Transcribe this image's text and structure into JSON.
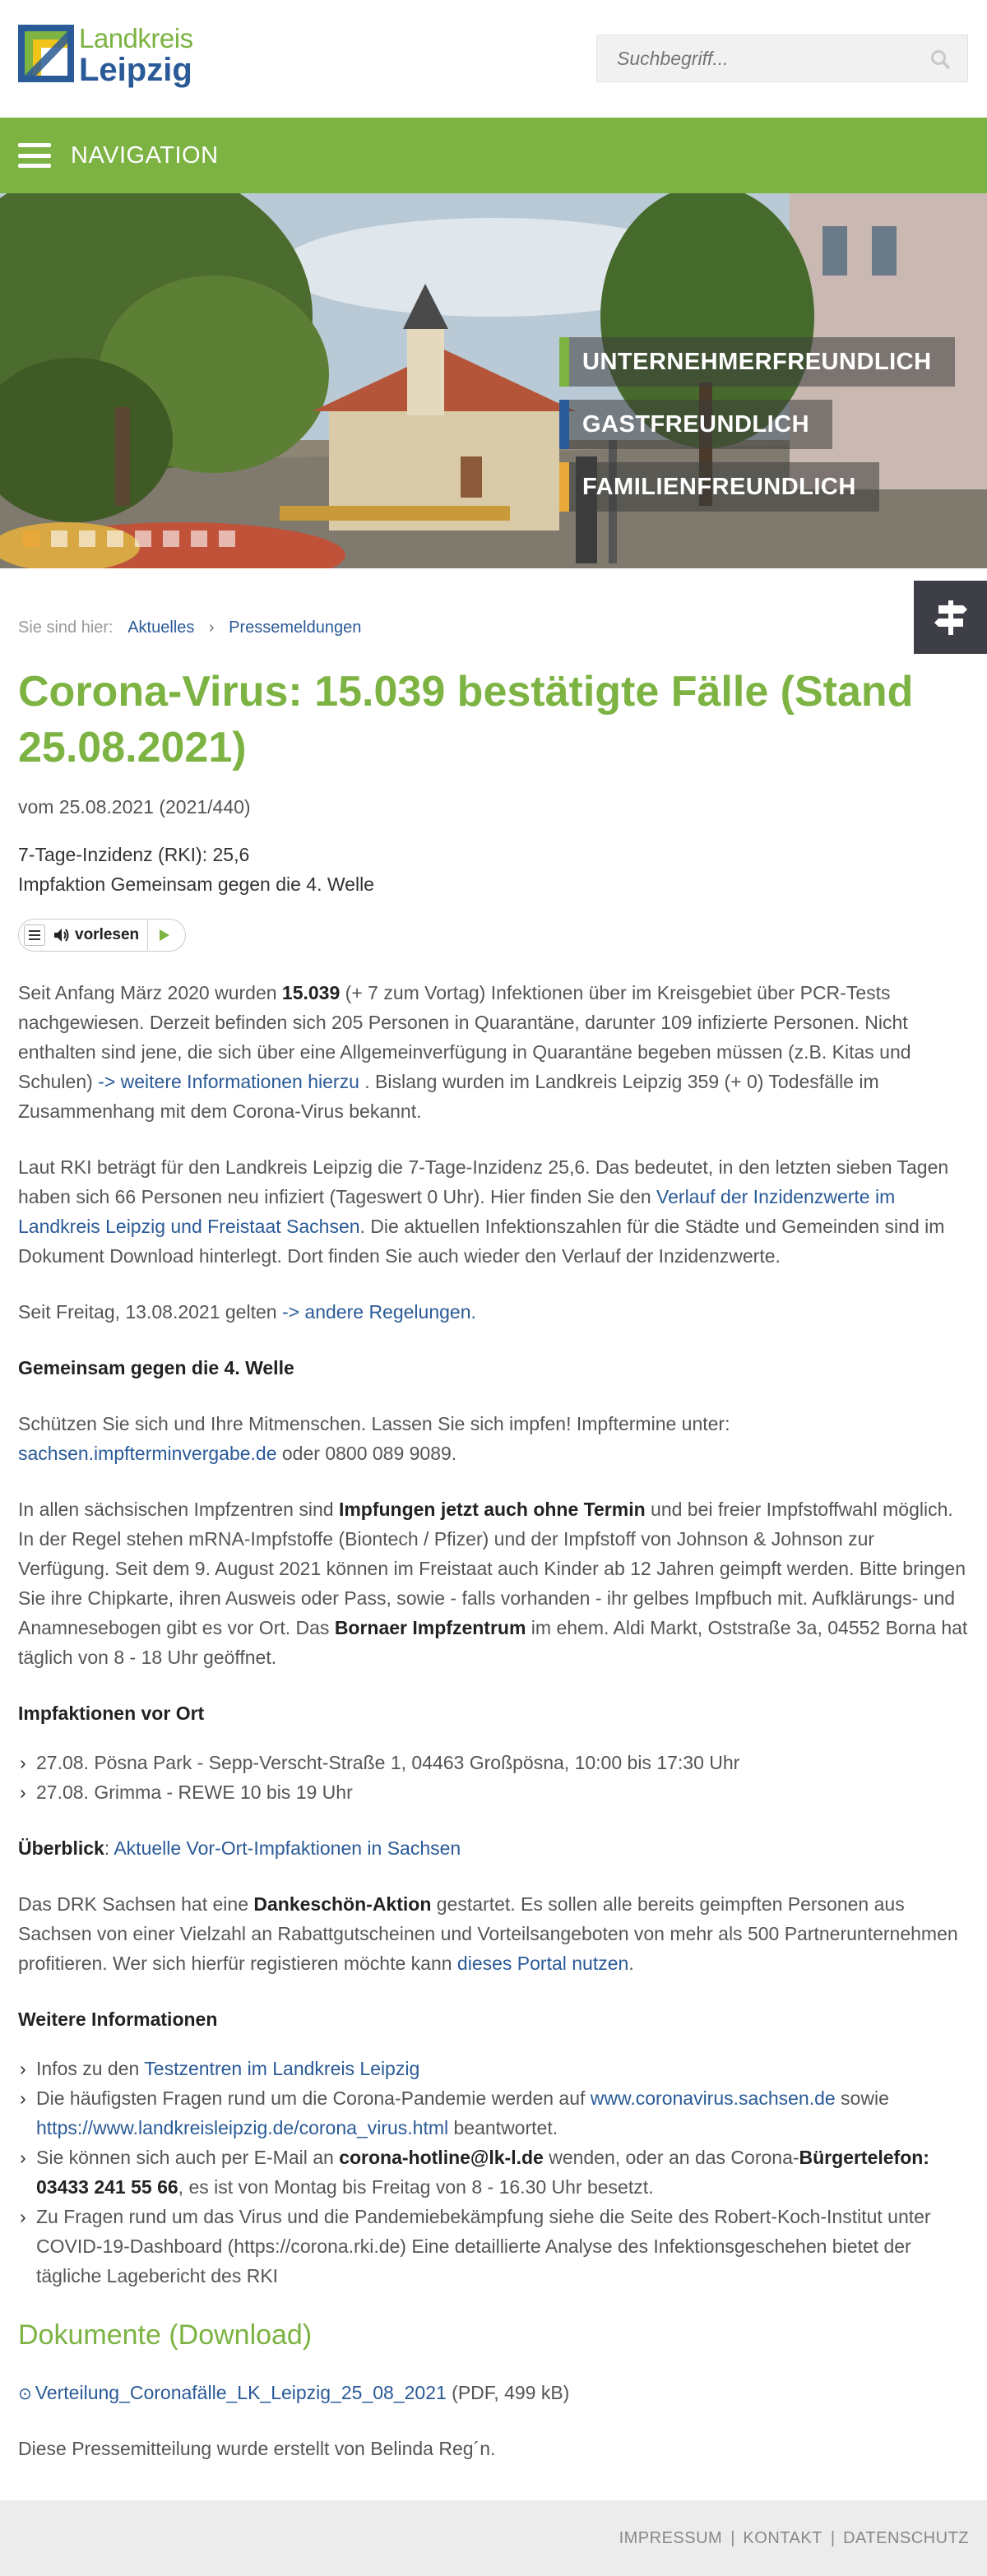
{
  "logo": {
    "line1": "Landkreis",
    "line2": "Leipzig"
  },
  "search": {
    "placeholder": "Suchbegriff..."
  },
  "nav": {
    "label": "NAVIGATION"
  },
  "hero": {
    "slogans": [
      {
        "text": "UNTERNEHMERFREUNDLICH",
        "color": "#7cb342"
      },
      {
        "text": "GASTFREUNDLICH",
        "color": "#2a5a97"
      },
      {
        "text": "FAMILIENFREUNDLICH",
        "color": "#e8a93a"
      }
    ],
    "slide_count": 8,
    "active_slide": 1
  },
  "breadcrumb": {
    "prefix": "Sie sind hier:",
    "items": [
      "Aktuelles",
      "Pressemeldungen"
    ],
    "separator": "›"
  },
  "article": {
    "title": "Corona-Virus: 15.039 bestätigte Fälle (Stand 25.08.2021)",
    "meta": "vom 25.08.2021 (2021/440)",
    "subhead1": "7-Tage-Inzidenz (RKI): 25,6",
    "subhead2": "Impfaktion Gemeinsam gegen die 4. Welle",
    "vorlesen": "vorlesen",
    "p1": {
      "a": "Seit Anfang März 2020 wurden ",
      "b": "15.039",
      "c": " (+ 7 zum Vortag) Infektionen über im Kreisgebiet über PCR-Tests nachgewiesen. Derzeit befinden sich 205 Personen in Quarantäne, darunter 109 infizierte Personen. Nicht enthalten sind jene, die sich über eine Allgemeinverfügung in Quarantäne begeben müssen (z.B. Kitas und Schulen) ",
      "link": "-> weitere Informationen hierzu",
      "d": " . Bislang wurden im Landkreis Leipzig 359 (+ 0) Todesfälle im Zusammenhang mit dem Corona-Virus bekannt."
    },
    "p2": {
      "a": "Laut RKI beträgt für den Landkreis Leipzig die 7-Tage-Inzidenz 25,6. Das bedeutet, in den letzten sieben Tagen haben sich 66 Personen neu infiziert (Tageswert 0 Uhr). Hier finden Sie den ",
      "link": "Verlauf der Inzidenzwerte im Landkreis Leipzig und Freistaat Sachsen",
      "b": ". Die aktuellen Infektionszahlen für die Städte und Gemeinden sind im Dokument Download hinterlegt. Dort finden Sie auch wieder den Verlauf der Inzidenzwerte."
    },
    "p3": {
      "a": "Seit Freitag, 13.08.2021 gelten  ",
      "link": "-> andere Regelungen."
    },
    "h_welle": "Gemeinsam gegen die 4. Welle",
    "p4": {
      "a": "Schützen Sie sich und Ihre Mitmenschen. Lassen Sie sich impfen! Impftermine unter: ",
      "link": "sachsen.impfterminvergabe.de",
      "b": " oder 0800 089 9089."
    },
    "p5": {
      "a": "In allen sächsischen Impfzentren sind ",
      "b": "Impfungen jetzt auch ohne Termin",
      "c": " und bei freier Impfstoffwahl möglich. In der Regel stehen mRNA-Impfstoffe (Biontech / Pfizer) und der Impfstoff von Johnson & Johnson zur Verfügung. Seit dem 9. August 2021 können im Freistaat auch Kinder ab 12 Jahren geimpft werden. Bitte bringen Sie ihre Chipkarte, ihren Ausweis oder Pass, sowie - falls vorhanden - ihr gelbes Impfbuch mit. Aufklärungs- und Anamnesebogen gibt es vor Ort. Das ",
      "d": "Bornaer Impfzentrum",
      "e": " im ehem. Aldi Markt, Oststraße 3a, 04552 Borna hat täglich von 8 - 18 Uhr geöffnet."
    },
    "h_vorort": "Impfaktionen vor Ort",
    "vorort_items": [
      "27.08. Pösna Park - Sepp-Verscht-Straße 1, 04463 Großpösna, 10:00 bis 17:30 Uhr",
      "27.08. Grimma - REWE 10 bis 19 Uhr"
    ],
    "ueberblick": {
      "label": "Überblick",
      "colon": ":  ",
      "link": "Aktuelle Vor-Ort-Impfaktionen in Sachsen"
    },
    "p6": {
      "a": "Das DRK Sachsen hat eine ",
      "b": "Dankeschön-Aktion",
      "c": " gestartet. Es sollen alle bereits geimpften Personen aus Sachsen von einer Vielzahl an Rabattgutscheinen und Vorteilsangeboten von mehr als 500 Partnerunternehmen profitieren. Wer sich hierfür registieren möchte kann ",
      "link": "dieses Portal nutzen",
      "d": "."
    },
    "h_weitere": "Weitere Informationen",
    "weitere": {
      "i1": {
        "a": "Infos zu den ",
        "link": "Testzentren im Landkreis Leipzig"
      },
      "i2": {
        "a": "Die häufigsten Fragen rund um die Corona-Pandemie werden auf ",
        "link1": "www.coronavirus.sachsen.de",
        "b": "  sowie ",
        "link2": "https://www.landkreisleipzig.de/corona_virus.html",
        "c": " beantwortet."
      },
      "i3": {
        "a": "Sie können sich auch per E-Mail an ",
        "b": "corona-hotline@lk-l.de",
        "c": " wenden, oder an das Corona-",
        "d": "Bürgertelefon: 03433 241 55 66",
        "e": ", es ist von Montag bis Freitag von 8 - 16.30 Uhr besetzt."
      },
      "i4": "Zu Fragen rund um das Virus und die Pandemiebekämpfung siehe die Seite des Robert-Koch-Institut unter COVID-19-Dashboard (https://corona.rki.de)  Eine detaillierte Analyse des Infektionsgeschehen bietet der tägliche Lagebericht des RKI"
    },
    "docs_title": "Dokumente (Download)",
    "doc": {
      "link": "Verteilung_Coronafälle_LK_Leipzig_25_08_2021",
      "info": " (PDF, 499 kB)"
    },
    "author": "Diese Pressemitteilung wurde erstellt von Belinda Reg´n."
  },
  "footer": {
    "links": [
      "IMPRESSUM",
      "KONTAKT",
      "DATENSCHUTZ"
    ],
    "separator": "|"
  }
}
